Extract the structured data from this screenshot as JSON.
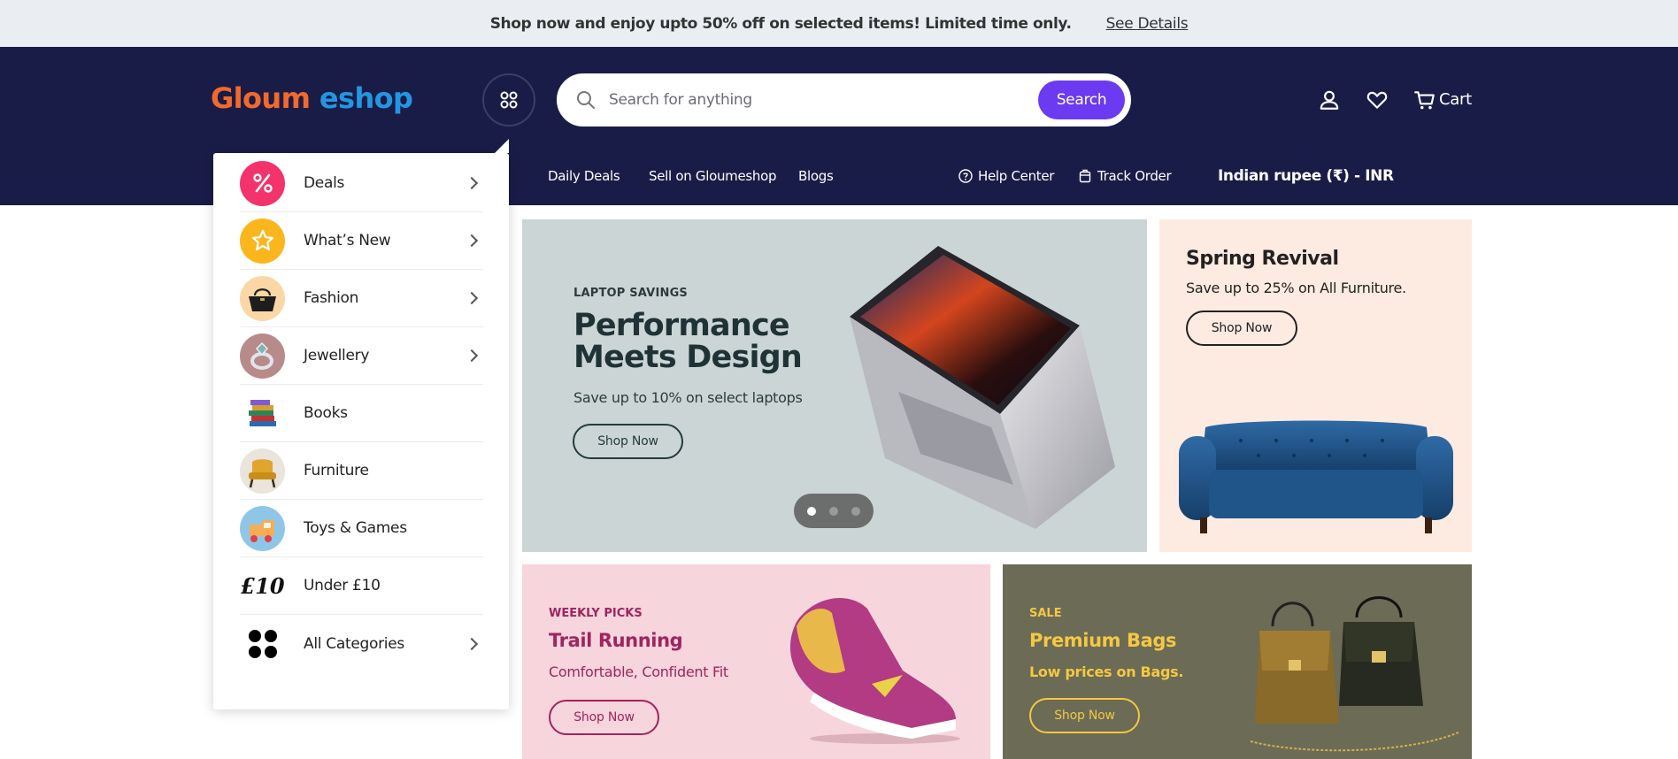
{
  "promo": {
    "text": "Shop now and enjoy upto 50% off on selected items! Limited time only.",
    "link": "See Details"
  },
  "header": {
    "logo_part1": "Gloum",
    "logo_part2": "eshop",
    "search_placeholder": "Search for anything",
    "search_button": "Search",
    "cart_label": "Cart",
    "nav": [
      "Daily Deals",
      "Sell on Gloumeshop",
      "Blogs"
    ],
    "help_center": "Help Center",
    "track_order": "Track Order",
    "currency": "Indian rupee (₹) - INR"
  },
  "categories": [
    {
      "label": "Deals",
      "icon": "percent-icon",
      "has_submenu": true
    },
    {
      "label": "What’s New",
      "icon": "star-icon",
      "has_submenu": true
    },
    {
      "label": "Fashion",
      "icon": "handbag-icon",
      "has_submenu": true
    },
    {
      "label": "Jewellery",
      "icon": "ring-icon",
      "has_submenu": true
    },
    {
      "label": "Books",
      "icon": "books-icon",
      "has_submenu": false
    },
    {
      "label": "Furniture",
      "icon": "chair-icon",
      "has_submenu": false
    },
    {
      "label": "Toys & Games",
      "icon": "toy-train-icon",
      "has_submenu": false
    },
    {
      "label": "Under £10",
      "icon_text": "£10",
      "has_submenu": false
    },
    {
      "label": "All Categories",
      "icon": "grid-dots-icon",
      "has_submenu": true
    }
  ],
  "hero": {
    "eyebrow": "LAPTOP SAVINGS",
    "title": "Performance Meets Design",
    "subtitle": "Save up to 10% on select laptops",
    "button": "Shop Now",
    "slides": 3,
    "active_slide": 1
  },
  "spring": {
    "title": "Spring Revival",
    "subtitle": "Save up to 25% on All Furniture.",
    "button": "Shop Now"
  },
  "shoe": {
    "eyebrow": "WEEKLY PICKS",
    "title": "Trail Running",
    "subtitle": "Comfortable, Confident Fit",
    "button": "Shop Now"
  },
  "bags": {
    "eyebrow": "SALE",
    "title": "Premium Bags",
    "subtitle": "Low prices on Bags.",
    "button": "Shop Now"
  },
  "colors": {
    "header_bg": "#1a1c48",
    "accent": "#6c3af0",
    "logo_orange": "#f26a2b",
    "logo_blue": "#2496e0"
  }
}
